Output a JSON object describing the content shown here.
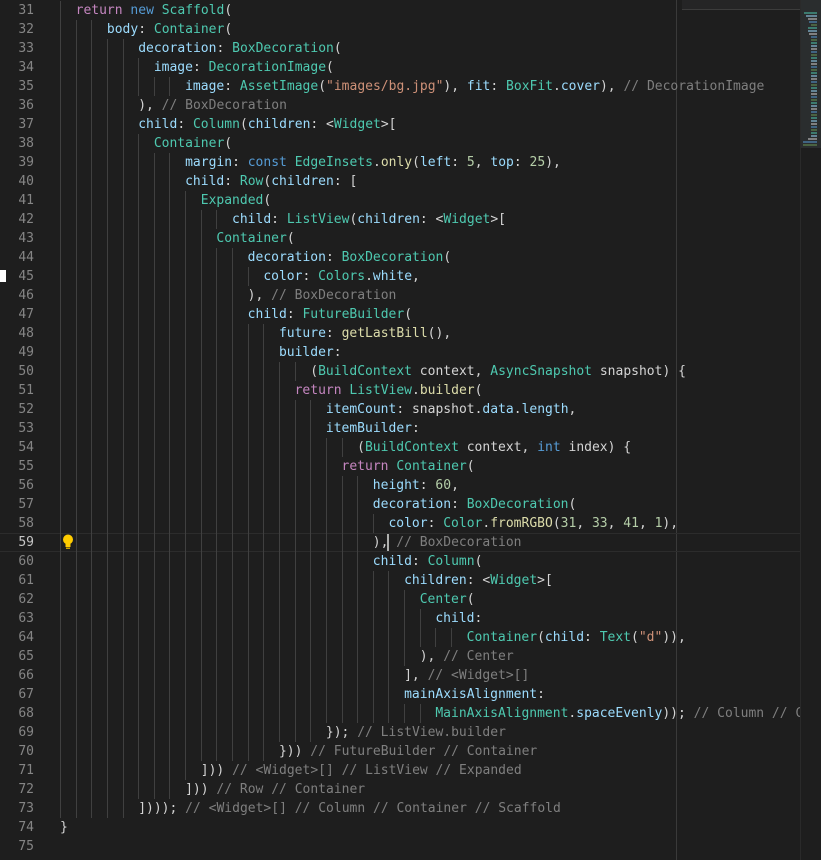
{
  "editor": {
    "current_line": 59,
    "lines": [
      {
        "n": "31",
        "indent": 1,
        "t": [
          {
            "c": "kw2",
            "s": "return "
          },
          {
            "c": "kw",
            "s": "new "
          },
          {
            "c": "ty",
            "s": "Scaffold"
          },
          {
            "c": "pl",
            "s": "("
          }
        ]
      },
      {
        "n": "32",
        "indent": 3,
        "t": [
          {
            "c": "pr",
            "s": "body"
          },
          {
            "c": "pl",
            "s": ": "
          },
          {
            "c": "ty",
            "s": "Container"
          },
          {
            "c": "pl",
            "s": "("
          }
        ]
      },
      {
        "n": "33",
        "indent": 5,
        "t": [
          {
            "c": "pr",
            "s": "decoration"
          },
          {
            "c": "pl",
            "s": ": "
          },
          {
            "c": "ty",
            "s": "BoxDecoration"
          },
          {
            "c": "pl",
            "s": "("
          }
        ]
      },
      {
        "n": "34",
        "indent": 6,
        "t": [
          {
            "c": "pr",
            "s": "image"
          },
          {
            "c": "pl",
            "s": ": "
          },
          {
            "c": "ty",
            "s": "DecorationImage"
          },
          {
            "c": "pl",
            "s": "("
          }
        ]
      },
      {
        "n": "35",
        "indent": 8,
        "t": [
          {
            "c": "pr",
            "s": "image"
          },
          {
            "c": "pl",
            "s": ": "
          },
          {
            "c": "ty",
            "s": "AssetImage"
          },
          {
            "c": "pl",
            "s": "("
          },
          {
            "c": "str",
            "s": "\"images/bg.jpg\""
          },
          {
            "c": "pl",
            "s": "), "
          },
          {
            "c": "pr",
            "s": "fit"
          },
          {
            "c": "pl",
            "s": ": "
          },
          {
            "c": "ty",
            "s": "BoxFit"
          },
          {
            "c": "pl",
            "s": "."
          },
          {
            "c": "pr",
            "s": "cover"
          },
          {
            "c": "pl",
            "s": "), "
          },
          {
            "c": "hint",
            "s": "// DecorationImage"
          }
        ]
      },
      {
        "n": "36",
        "indent": 5,
        "t": [
          {
            "c": "pl",
            "s": "), "
          },
          {
            "c": "hint",
            "s": "// BoxDecoration"
          }
        ]
      },
      {
        "n": "37",
        "indent": 5,
        "t": [
          {
            "c": "pr",
            "s": "child"
          },
          {
            "c": "pl",
            "s": ": "
          },
          {
            "c": "ty",
            "s": "Column"
          },
          {
            "c": "pl",
            "s": "("
          },
          {
            "c": "pr",
            "s": "children"
          },
          {
            "c": "pl",
            "s": ": <"
          },
          {
            "c": "ty",
            "s": "Widget"
          },
          {
            "c": "pl",
            "s": ">["
          }
        ]
      },
      {
        "n": "38",
        "indent": 6,
        "t": [
          {
            "c": "ty",
            "s": "Container"
          },
          {
            "c": "pl",
            "s": "("
          }
        ]
      },
      {
        "n": "39",
        "indent": 8,
        "t": [
          {
            "c": "pr",
            "s": "margin"
          },
          {
            "c": "pl",
            "s": ": "
          },
          {
            "c": "kw",
            "s": "const "
          },
          {
            "c": "ty",
            "s": "EdgeInsets"
          },
          {
            "c": "pl",
            "s": "."
          },
          {
            "c": "fn",
            "s": "only"
          },
          {
            "c": "pl",
            "s": "("
          },
          {
            "c": "pr",
            "s": "left"
          },
          {
            "c": "pl",
            "s": ": "
          },
          {
            "c": "num",
            "s": "5"
          },
          {
            "c": "pl",
            "s": ", "
          },
          {
            "c": "pr",
            "s": "top"
          },
          {
            "c": "pl",
            "s": ": "
          },
          {
            "c": "num",
            "s": "25"
          },
          {
            "c": "pl",
            "s": "),"
          }
        ]
      },
      {
        "n": "40",
        "indent": 8,
        "t": [
          {
            "c": "pr",
            "s": "child"
          },
          {
            "c": "pl",
            "s": ": "
          },
          {
            "c": "ty",
            "s": "Row"
          },
          {
            "c": "pl",
            "s": "("
          },
          {
            "c": "pr",
            "s": "children"
          },
          {
            "c": "pl",
            "s": ": ["
          }
        ]
      },
      {
        "n": "41",
        "indent": 9,
        "t": [
          {
            "c": "ty",
            "s": "Expanded"
          },
          {
            "c": "pl",
            "s": "("
          }
        ]
      },
      {
        "n": "42",
        "indent": 11,
        "t": [
          {
            "c": "pr",
            "s": "child"
          },
          {
            "c": "pl",
            "s": ": "
          },
          {
            "c": "ty",
            "s": "ListView"
          },
          {
            "c": "pl",
            "s": "("
          },
          {
            "c": "pr",
            "s": "children"
          },
          {
            "c": "pl",
            "s": ": <"
          },
          {
            "c": "ty",
            "s": "Widget"
          },
          {
            "c": "pl",
            "s": ">["
          }
        ]
      },
      {
        "n": "43",
        "indent": 10,
        "t": [
          {
            "c": "ty",
            "s": "Container"
          },
          {
            "c": "pl",
            "s": "("
          }
        ]
      },
      {
        "n": "44",
        "indent": 12,
        "t": [
          {
            "c": "pr",
            "s": "decoration"
          },
          {
            "c": "pl",
            "s": ": "
          },
          {
            "c": "ty",
            "s": "BoxDecoration"
          },
          {
            "c": "pl",
            "s": "("
          }
        ]
      },
      {
        "n": "45",
        "indent": 13,
        "t": [
          {
            "c": "pr",
            "s": "color"
          },
          {
            "c": "pl",
            "s": ": "
          },
          {
            "c": "ty",
            "s": "Colors"
          },
          {
            "c": "pl",
            "s": "."
          },
          {
            "c": "pr",
            "s": "white"
          },
          {
            "c": "pl",
            "s": ","
          }
        ]
      },
      {
        "n": "46",
        "indent": 12,
        "t": [
          {
            "c": "pl",
            "s": "), "
          },
          {
            "c": "hint",
            "s": "// BoxDecoration"
          }
        ]
      },
      {
        "n": "47",
        "indent": 12,
        "t": [
          {
            "c": "pr",
            "s": "child"
          },
          {
            "c": "pl",
            "s": ": "
          },
          {
            "c": "ty",
            "s": "FutureBuilder"
          },
          {
            "c": "pl",
            "s": "("
          }
        ]
      },
      {
        "n": "48",
        "indent": 14,
        "t": [
          {
            "c": "pr",
            "s": "future"
          },
          {
            "c": "pl",
            "s": ": "
          },
          {
            "c": "fn",
            "s": "getLastBill"
          },
          {
            "c": "pl",
            "s": "(),"
          }
        ]
      },
      {
        "n": "49",
        "indent": 14,
        "t": [
          {
            "c": "pr",
            "s": "builder"
          },
          {
            "c": "pl",
            "s": ":"
          }
        ]
      },
      {
        "n": "50",
        "indent": 16,
        "t": [
          {
            "c": "pl",
            "s": "("
          },
          {
            "c": "ty",
            "s": "BuildContext"
          },
          {
            "c": "pl",
            "s": " context, "
          },
          {
            "c": "ty",
            "s": "AsyncSnapshot"
          },
          {
            "c": "pl",
            "s": " snapshot) {"
          }
        ]
      },
      {
        "n": "51",
        "indent": 15,
        "t": [
          {
            "c": "kw2",
            "s": "return "
          },
          {
            "c": "ty",
            "s": "ListView"
          },
          {
            "c": "pl",
            "s": "."
          },
          {
            "c": "fn",
            "s": "builder"
          },
          {
            "c": "pl",
            "s": "("
          }
        ]
      },
      {
        "n": "52",
        "indent": 17,
        "t": [
          {
            "c": "pr",
            "s": "itemCount"
          },
          {
            "c": "pl",
            "s": ": snapshot."
          },
          {
            "c": "pr",
            "s": "data"
          },
          {
            "c": "pl",
            "s": "."
          },
          {
            "c": "pr",
            "s": "length"
          },
          {
            "c": "pl",
            "s": ","
          }
        ]
      },
      {
        "n": "53",
        "indent": 17,
        "t": [
          {
            "c": "pr",
            "s": "itemBuilder"
          },
          {
            "c": "pl",
            "s": ":"
          }
        ]
      },
      {
        "n": "54",
        "indent": 19,
        "t": [
          {
            "c": "pl",
            "s": "("
          },
          {
            "c": "ty",
            "s": "BuildContext"
          },
          {
            "c": "pl",
            "s": " context, "
          },
          {
            "c": "kw",
            "s": "int"
          },
          {
            "c": "pl",
            "s": " index) {"
          }
        ]
      },
      {
        "n": "55",
        "indent": 18,
        "t": [
          {
            "c": "kw2",
            "s": "return "
          },
          {
            "c": "ty",
            "s": "Container"
          },
          {
            "c": "pl",
            "s": "("
          }
        ]
      },
      {
        "n": "56",
        "indent": 20,
        "t": [
          {
            "c": "pr",
            "s": "height"
          },
          {
            "c": "pl",
            "s": ": "
          },
          {
            "c": "num",
            "s": "60"
          },
          {
            "c": "pl",
            "s": ","
          }
        ]
      },
      {
        "n": "57",
        "indent": 20,
        "t": [
          {
            "c": "pr",
            "s": "decoration"
          },
          {
            "c": "pl",
            "s": ": "
          },
          {
            "c": "ty",
            "s": "BoxDecoration"
          },
          {
            "c": "pl",
            "s": "("
          }
        ]
      },
      {
        "n": "58",
        "indent": 21,
        "t": [
          {
            "c": "pr",
            "s": "color"
          },
          {
            "c": "pl",
            "s": ": "
          },
          {
            "c": "ty",
            "s": "Color"
          },
          {
            "c": "pl",
            "s": "."
          },
          {
            "c": "fn",
            "s": "fromRGBO"
          },
          {
            "c": "pl",
            "s": "("
          },
          {
            "c": "num",
            "s": "31"
          },
          {
            "c": "pl",
            "s": ", "
          },
          {
            "c": "num",
            "s": "33"
          },
          {
            "c": "pl",
            "s": ", "
          },
          {
            "c": "num",
            "s": "41"
          },
          {
            "c": "pl",
            "s": ", "
          },
          {
            "c": "num",
            "s": "1"
          },
          {
            "c": "pl",
            "s": "),"
          }
        ]
      },
      {
        "n": "59",
        "indent": 20,
        "t": [
          {
            "c": "pl",
            "s": "), "
          },
          {
            "c": "hint",
            "s": "// BoxDecoration"
          }
        ]
      },
      {
        "n": "60",
        "indent": 20,
        "t": [
          {
            "c": "pr",
            "s": "child"
          },
          {
            "c": "pl",
            "s": ": "
          },
          {
            "c": "ty",
            "s": "Column"
          },
          {
            "c": "pl",
            "s": "("
          }
        ]
      },
      {
        "n": "61",
        "indent": 22,
        "t": [
          {
            "c": "pr",
            "s": "children"
          },
          {
            "c": "pl",
            "s": ": <"
          },
          {
            "c": "ty",
            "s": "Widget"
          },
          {
            "c": "pl",
            "s": ">["
          }
        ]
      },
      {
        "n": "62",
        "indent": 23,
        "t": [
          {
            "c": "ty",
            "s": "Center"
          },
          {
            "c": "pl",
            "s": "("
          }
        ]
      },
      {
        "n": "63",
        "indent": 24,
        "t": [
          {
            "c": "pr",
            "s": "child"
          },
          {
            "c": "pl",
            "s": ":"
          }
        ]
      },
      {
        "n": "64",
        "indent": 26,
        "t": [
          {
            "c": "ty",
            "s": "Container"
          },
          {
            "c": "pl",
            "s": "("
          },
          {
            "c": "pr",
            "s": "child"
          },
          {
            "c": "pl",
            "s": ": "
          },
          {
            "c": "ty",
            "s": "Text"
          },
          {
            "c": "pl",
            "s": "("
          },
          {
            "c": "str",
            "s": "\"d\""
          },
          {
            "c": "pl",
            "s": ")),"
          }
        ]
      },
      {
        "n": "65",
        "indent": 23,
        "t": [
          {
            "c": "pl",
            "s": "), "
          },
          {
            "c": "hint",
            "s": "// Center"
          }
        ]
      },
      {
        "n": "66",
        "indent": 22,
        "t": [
          {
            "c": "pl",
            "s": "], "
          },
          {
            "c": "hint",
            "s": "// <Widget>[]"
          }
        ]
      },
      {
        "n": "67",
        "indent": 22,
        "t": [
          {
            "c": "pr",
            "s": "mainAxisAlignment"
          },
          {
            "c": "pl",
            "s": ":"
          }
        ]
      },
      {
        "n": "68",
        "indent": 24,
        "t": [
          {
            "c": "ty",
            "s": "MainAxisAlignment"
          },
          {
            "c": "pl",
            "s": "."
          },
          {
            "c": "pr",
            "s": "spaceEvenly"
          },
          {
            "c": "pl",
            "s": ")); "
          },
          {
            "c": "hint",
            "s": "// Column // Co"
          }
        ]
      },
      {
        "n": "69",
        "indent": 17,
        "t": [
          {
            "c": "pl",
            "s": "}); "
          },
          {
            "c": "hint",
            "s": "// ListView.builder"
          }
        ]
      },
      {
        "n": "70",
        "indent": 14,
        "t": [
          {
            "c": "pl",
            "s": "})) "
          },
          {
            "c": "hint",
            "s": "// FutureBuilder // Container"
          }
        ]
      },
      {
        "n": "71",
        "indent": 9,
        "t": [
          {
            "c": "pl",
            "s": "])) "
          },
          {
            "c": "hint",
            "s": "// <Widget>[] // ListView // Expanded"
          }
        ]
      },
      {
        "n": "72",
        "indent": 8,
        "t": [
          {
            "c": "pl",
            "s": "])) "
          },
          {
            "c": "hint",
            "s": "// Row // Container"
          }
        ]
      },
      {
        "n": "73",
        "indent": 5,
        "t": [
          {
            "c": "pl",
            "s": "]))); "
          },
          {
            "c": "hint",
            "s": "// <Widget>[] // Column // Container // Scaffold"
          }
        ]
      },
      {
        "n": "74",
        "indent": 0,
        "t": [
          {
            "c": "pl",
            "s": "}"
          }
        ]
      },
      {
        "n": "75",
        "indent": 0,
        "t": []
      }
    ]
  },
  "icons": {
    "lightbulb": "lightbulb-icon",
    "bulb_color": "#ffcc00"
  },
  "colors": {
    "background": "#1e1e1e",
    "line_number": "#858585",
    "indent_guide": "#404040"
  }
}
